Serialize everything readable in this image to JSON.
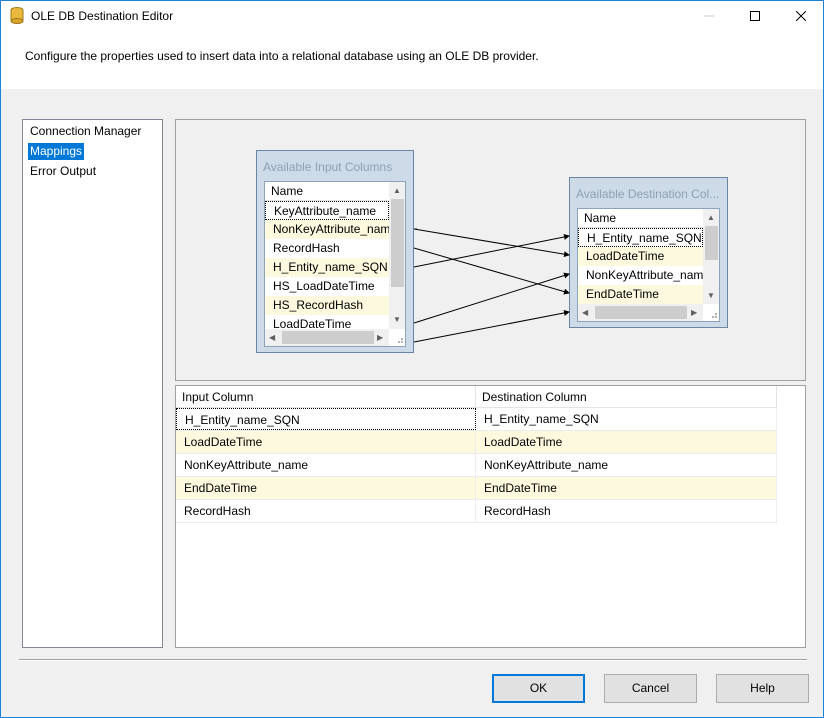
{
  "window": {
    "title": "OLE DB Destination Editor",
    "description": "Configure the properties used to insert data into a relational database using an OLE DB provider."
  },
  "nav": {
    "items": [
      {
        "label": "Connection Manager",
        "selected": false
      },
      {
        "label": "Mappings",
        "selected": true
      },
      {
        "label": "Error Output",
        "selected": false
      }
    ]
  },
  "input_columns": {
    "title": "Available Input Columns",
    "header": "Name",
    "rows": [
      "KeyAttribute_name",
      "NonKeyAttribute_name",
      "RecordHash",
      "H_Entity_name_SQN",
      "HS_LoadDateTime",
      "HS_RecordHash",
      "LoadDateTime"
    ]
  },
  "destination_columns": {
    "title": "Available Destination Col...",
    "header": "Name",
    "rows": [
      "H_Entity_name_SQN",
      "LoadDateTime",
      "NonKeyAttribute_name",
      "EndDateTime"
    ]
  },
  "mappings": {
    "headers": {
      "input": "Input Column",
      "destination": "Destination Column"
    },
    "rows": [
      {
        "input": "H_Entity_name_SQN",
        "destination": "H_Entity_name_SQN"
      },
      {
        "input": "LoadDateTime",
        "destination": "LoadDateTime"
      },
      {
        "input": "NonKeyAttribute_name",
        "destination": "NonKeyAttribute_name"
      },
      {
        "input": "EndDateTime",
        "destination": "EndDateTime"
      },
      {
        "input": "RecordHash",
        "destination": "RecordHash"
      }
    ]
  },
  "buttons": {
    "ok": "OK",
    "cancel": "Cancel",
    "help": "Help"
  },
  "colors": {
    "accent": "#0078d7",
    "alt_row": "#fcf9de",
    "box": "#cddbe9"
  }
}
